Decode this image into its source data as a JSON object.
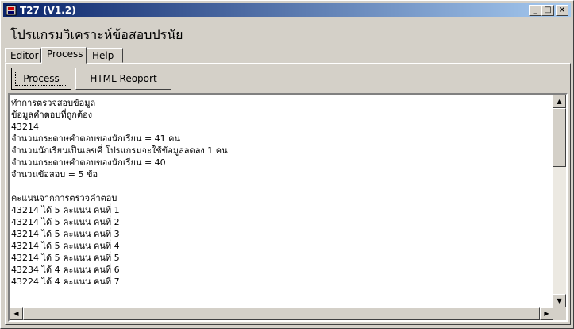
{
  "window": {
    "title": "T27 (V1.2)"
  },
  "header": {
    "title": "โปรแกรมวิเคราะห์ข้อสอบปรนัย"
  },
  "tabs": [
    {
      "label": "Editor",
      "active": false
    },
    {
      "label": "Process",
      "active": true
    },
    {
      "label": "Help",
      "active": false
    }
  ],
  "toolbar": {
    "process_label": "Process",
    "html_report_label": "HTML Reoport"
  },
  "titlebar_buttons": {
    "minimize": "_",
    "maximize": "□",
    "close": "×"
  },
  "output": {
    "lines": [
      "ทำการตรวจสอบข้อมูล",
      "ข้อมูลคำตอบที่ถูกต้อง",
      "43214",
      "จำนวนกระดาษคำตอบของนักเรียน = 41 คน",
      "จำนวนนักเรียนเป็นเลขคี่ โปรแกรมจะใช้ข้อมูลลดลง 1 คน",
      "จำนวนกระดาษคำตอบของนักเรียน = 40",
      "จำนวนข้อสอบ = 5 ข้อ",
      "",
      "คะแนนจากการตรวจคำตอบ",
      "43214 ได้ 5 คะแนน คนที่ 1",
      "43214 ได้ 5 คะแนน คนที่ 2",
      "43214 ได้ 5 คะแนน คนที่ 3",
      "43214 ได้ 5 คะแนน คนที่ 4",
      "43214 ได้ 5 คะแนน คนที่ 5",
      "43234 ได้ 4 คะแนน คนที่ 6",
      "43224 ได้ 4 คะแนน คนที่ 7"
    ]
  },
  "colors": {
    "title_start": "#0a246a",
    "title_end": "#a6caf0",
    "face": "#d4d0c8"
  }
}
